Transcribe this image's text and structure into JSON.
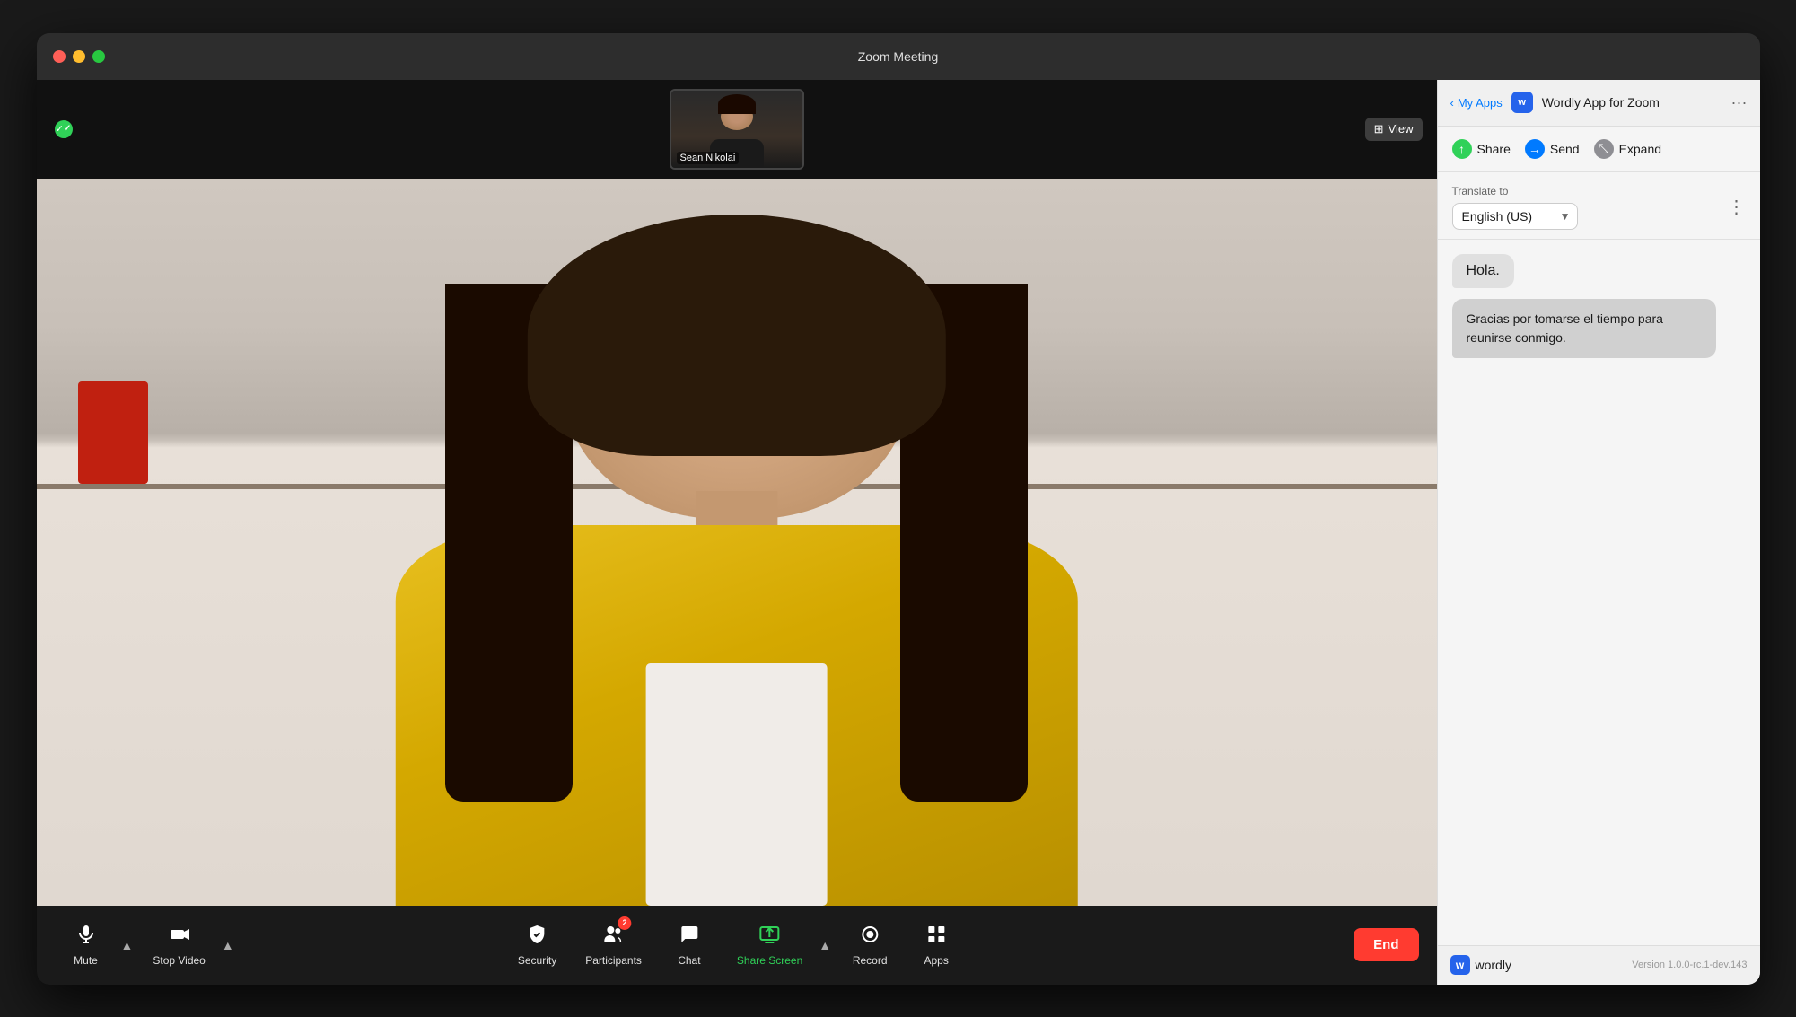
{
  "window": {
    "title": "Zoom Meeting",
    "bg_color": "#1c1c1c"
  },
  "titlebar": {
    "title": "Zoom Meeting",
    "traffic_lights": [
      "red",
      "yellow",
      "green"
    ]
  },
  "video": {
    "participant_name": "Sean Nikolai",
    "view_label": "View"
  },
  "toolbar": {
    "mute_label": "Mute",
    "stop_video_label": "Stop Video",
    "security_label": "Security",
    "participants_label": "Participants",
    "participants_count": "2",
    "chat_label": "Chat",
    "share_screen_label": "Share Screen",
    "record_label": "Record",
    "apps_label": "Apps",
    "end_label": "End"
  },
  "right_panel": {
    "back_label": "My Apps",
    "app_title": "Wordly App for Zoom",
    "share_label": "Share",
    "send_label": "Send",
    "expand_label": "Expand",
    "translate_to_label": "Translate to",
    "language": "English (US)",
    "bubble1": "Hola.",
    "bubble2": "Gracias por tomarse el tiempo para reunirse conmigo.",
    "footer_logo": "wordly",
    "version": "Version 1.0.0-rc.1-dev.143"
  }
}
